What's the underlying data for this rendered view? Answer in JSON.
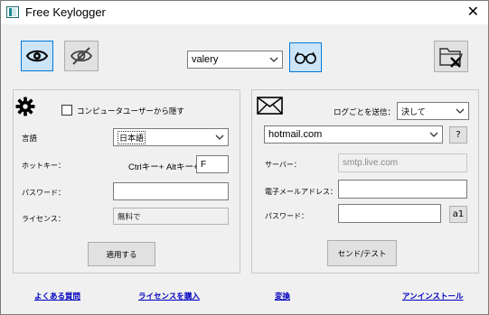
{
  "window": {
    "title": "Free Keylogger"
  },
  "toolbar": {
    "user_dropdown": {
      "selected": "valery"
    }
  },
  "left_panel": {
    "hide_checkbox_label": "コンピュータユーザーから隠す",
    "language_label": "言語",
    "language_selected": "日本語",
    "hotkey_label": "ホットキー：",
    "hotkey_text": "Ctrlキー+ Altキー+",
    "hotkey_value": "F",
    "password_label": "パスワード：",
    "password_value": "",
    "license_label": "ライセンス：",
    "license_value": "無料で",
    "apply_button": "適用する"
  },
  "right_panel": {
    "send_logs_label": "ログごとを送信：",
    "send_logs_selected": "決して",
    "email_provider_selected": "hotmail.com",
    "help_button": "?",
    "server_label": "サーバー：",
    "server_value": "smtp.live.com",
    "email_label": "電子メールアドレス：",
    "email_value": "",
    "password_label": "パスワード：",
    "password_value": "",
    "a1_button": "a1",
    "send_test_button": "センド/テスト"
  },
  "footer": {
    "faq_link": "よくある質問",
    "buy_license_link": "ライセンスを購入",
    "uninstall_mid_link": "変換",
    "uninstall_link": "アンインストール"
  },
  "colors": {
    "accent": "#0078d7",
    "accent_bg": "#cce4f7",
    "window_bg": "#f0f0f0",
    "link": "#0000c0"
  }
}
